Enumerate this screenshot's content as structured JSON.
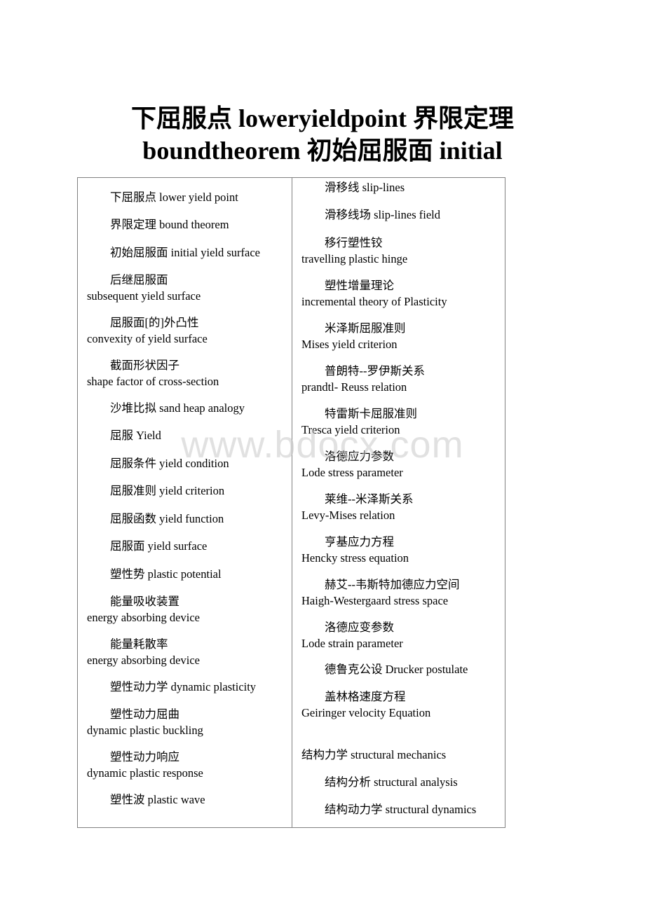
{
  "title": {
    "line1": "下屈服点 loweryieldpoint 界限定理",
    "line2": "boundtheorem 初始屈服面 initial"
  },
  "watermark": "www.bdocx.com",
  "left_column": [
    {
      "zh": "下屈服点",
      "en": "lower yield point",
      "layout": "flat"
    },
    {
      "zh": "界限定理",
      "en": "bound theorem",
      "layout": "flat"
    },
    {
      "zh": "初始屈服面",
      "en": "initial yield surface",
      "layout": "flat"
    },
    {
      "zh": "后继屈服面",
      "en": "subsequent yield surface",
      "layout": "wrap"
    },
    {
      "zh": "屈服面[的]外凸性",
      "en": "convexity of yield surface",
      "layout": "wrap"
    },
    {
      "zh": "截面形状因子",
      "en": "shape factor of cross-section",
      "layout": "wrap"
    },
    {
      "zh": "沙堆比拟",
      "en": "sand heap analogy",
      "layout": "flat"
    },
    {
      "zh": "屈服",
      "en": "Yield",
      "layout": "flat"
    },
    {
      "zh": "屈服条件",
      "en": "yield condition",
      "layout": "flat"
    },
    {
      "zh": "屈服准则",
      "en": "yield criterion",
      "layout": "flat"
    },
    {
      "zh": "屈服函数",
      "en": "yield function",
      "layout": "flat"
    },
    {
      "zh": "屈服面",
      "en": "yield surface",
      "layout": "flat"
    },
    {
      "zh": "塑性势",
      "en": "plastic potential",
      "layout": "flat"
    },
    {
      "zh": "能量吸收装置",
      "en": "energy absorbing device",
      "layout": "wrap"
    },
    {
      "zh": "能量耗散率",
      "en": "energy absorbing device",
      "layout": "wrap"
    },
    {
      "zh": "塑性动力学",
      "en": "dynamic plasticity",
      "layout": "flat"
    },
    {
      "zh": "塑性动力屈曲",
      "en": "dynamic plastic buckling",
      "layout": "wrap"
    },
    {
      "zh": "塑性动力响应",
      "en": "dynamic plastic response",
      "layout": "wrap"
    },
    {
      "zh": "塑性波",
      "en": "plastic wave",
      "layout": "flat"
    }
  ],
  "right_column": [
    {
      "zh": "滑移线",
      "en": "slip-lines",
      "layout": "flat"
    },
    {
      "zh": "滑移线场",
      "en": "slip-lines field",
      "layout": "flat"
    },
    {
      "zh": "移行塑性铰",
      "en": "travelling plastic hinge",
      "layout": "wrap"
    },
    {
      "zh": "塑性增量理论",
      "en": "incremental theory of Plasticity",
      "layout": "wrap"
    },
    {
      "zh": "米泽斯屈服准则",
      "en": "Mises yield criterion",
      "layout": "wrap"
    },
    {
      "zh": "普朗特--罗伊斯关系",
      "en": "prandtl- Reuss relation",
      "layout": "wrap"
    },
    {
      "zh": "特雷斯卡屈服准则",
      "en": "Tresca yield criterion",
      "layout": "wrap"
    },
    {
      "zh": "洛德应力参数",
      "en": "Lode stress parameter",
      "layout": "wrap"
    },
    {
      "zh": "莱维--米泽斯关系",
      "en": "Levy-Mises relation",
      "layout": "wrap"
    },
    {
      "zh": "亨基应力方程",
      "en": "Hencky stress equation",
      "layout": "wrap"
    },
    {
      "zh": "赫艾--韦斯特加德应力空间",
      "en": "Haigh-Westergaard stress space",
      "layout": "wrap"
    },
    {
      "zh": "洛德应变参数",
      "en": "Lode strain parameter",
      "layout": "wrap"
    },
    {
      "zh": "德鲁克公设",
      "en": "Drucker postulate",
      "layout": "flat"
    },
    {
      "zh": "盖林格速度方程",
      "en": "Geiringer velocity Equation",
      "layout": "wrap"
    },
    {
      "zh": "结构力学",
      "en": "structural mechanics",
      "layout": "flat-noindent"
    },
    {
      "zh": "结构分析",
      "en": "structural analysis",
      "layout": "flat"
    },
    {
      "zh": "结构动力学",
      "en": "structural dynamics",
      "layout": "flat"
    }
  ]
}
